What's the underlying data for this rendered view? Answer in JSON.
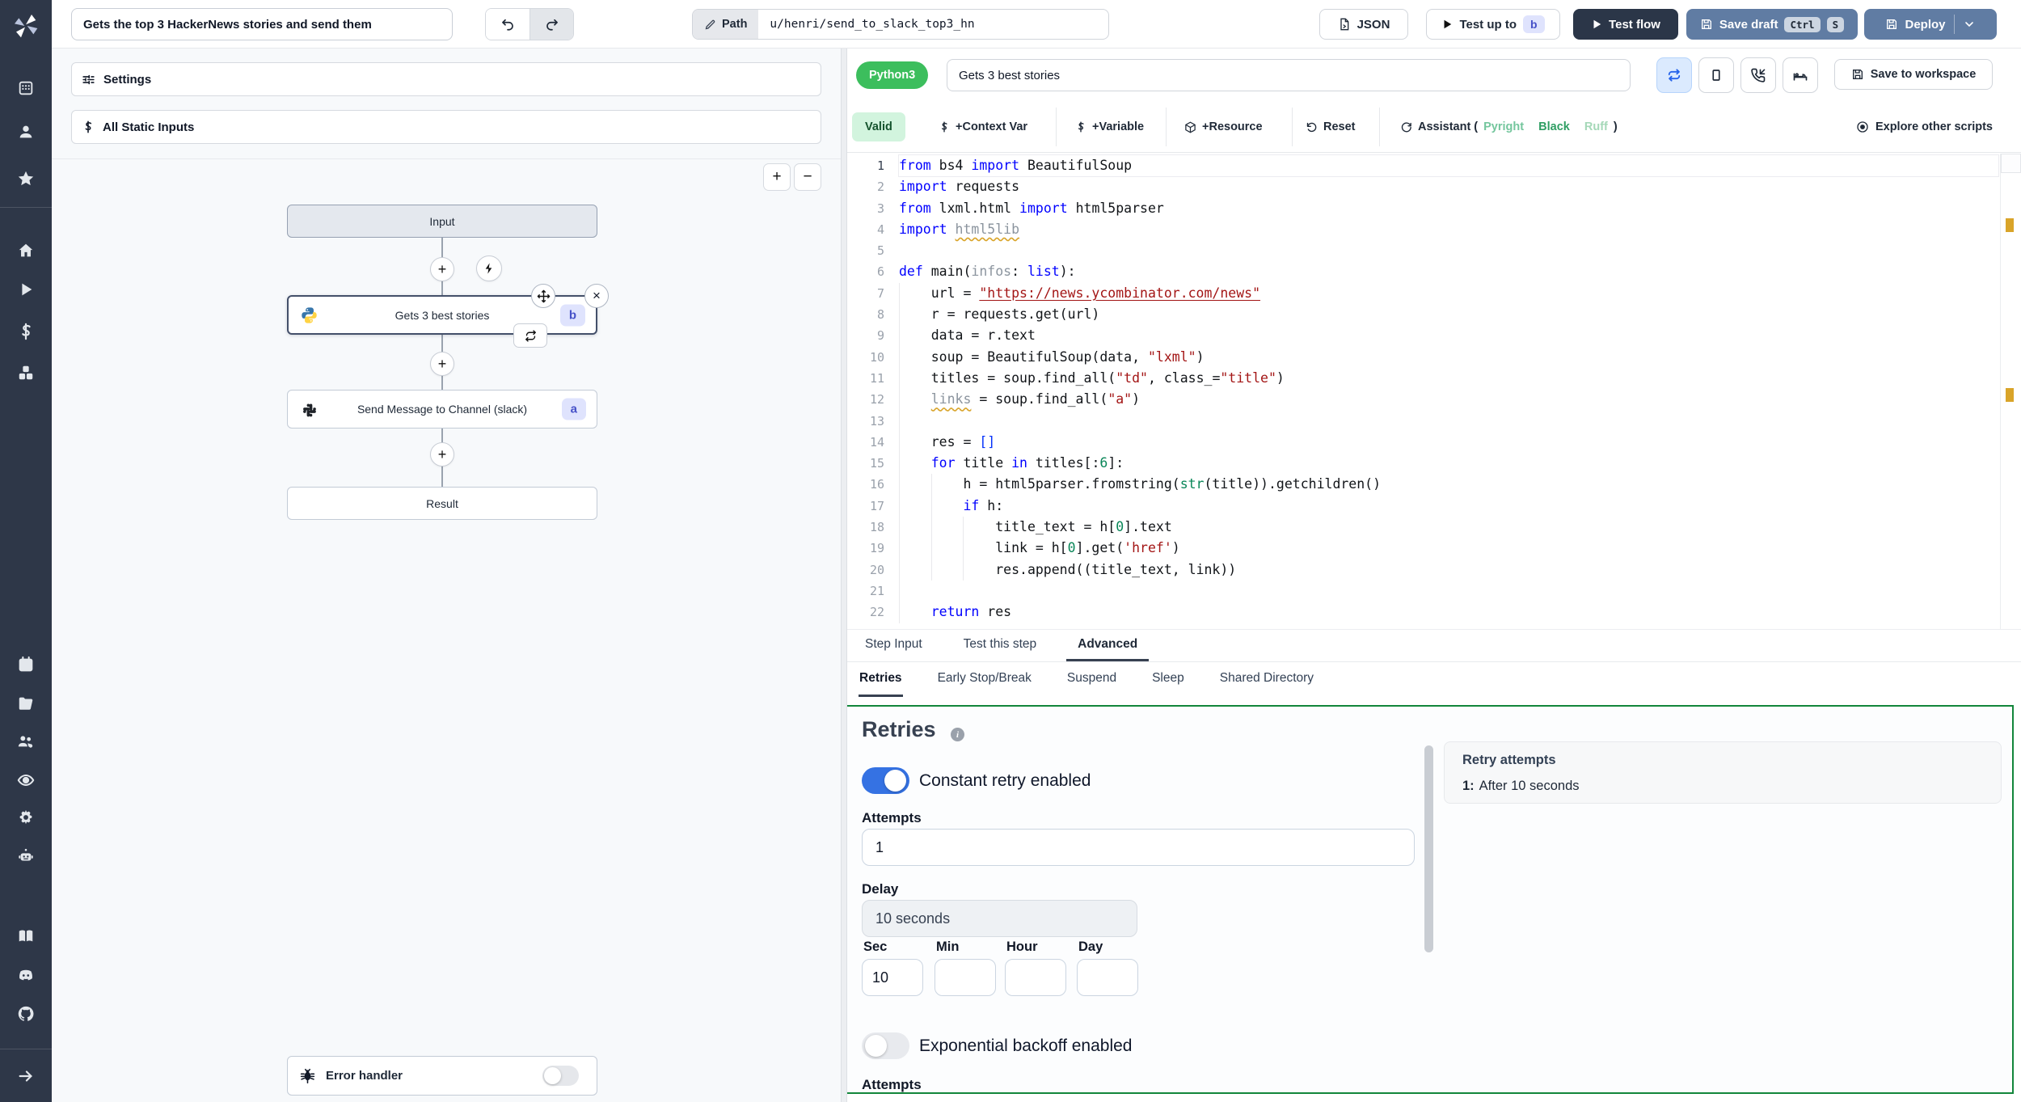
{
  "topbar": {
    "flow_title": "Gets the top 3 HackerNews stories and send them",
    "path_label": "Path",
    "path_value": "u/henri/send_to_slack_top3_hn",
    "json_label": "JSON",
    "test_up_to_label": "Test up to",
    "test_up_to_badge": "b",
    "test_flow_label": "Test flow",
    "save_draft_label": "Save draft",
    "save_draft_kbd": [
      "Ctrl",
      "S"
    ],
    "deploy_label": "Deploy"
  },
  "flow": {
    "settings_label": "Settings",
    "static_inputs_label": "All Static Inputs",
    "zoom_in": "+",
    "zoom_out": "−",
    "input_label": "Input",
    "step_b_label": "Gets 3 best stories",
    "step_b_badge": "b",
    "step_a_label": "Send Message to Channel (slack)",
    "step_a_badge": "a",
    "result_label": "Result",
    "error_handler_label": "Error handler"
  },
  "editor": {
    "language_badge": "Python3",
    "title_value": "Gets 3 best stories",
    "save_to_workspace_label": "Save to workspace",
    "valid_label": "Valid",
    "actions": [
      {
        "label": "+Context Var"
      },
      {
        "label": "+Variable"
      },
      {
        "label": "+Resource"
      },
      {
        "label": "Reset"
      }
    ],
    "assistant_prefix": "Assistant (",
    "assistant_linters": [
      {
        "name": "Pyright",
        "color": "#74c69d"
      },
      {
        "name": "Black",
        "color": "#2f9e63"
      },
      {
        "name": "Ruff",
        "color": "#a5d8b8"
      }
    ],
    "assistant_suffix": ")",
    "explore_label": "Explore other scripts",
    "accent_colors": {
      "valid_bg": "#d2f4de",
      "language_badge_bg": "#3cbe5d",
      "retry_border": "#12863b",
      "toggle_on": "#3572e3"
    },
    "code": {
      "lines": [
        [
          [
            "k",
            "from"
          ],
          [
            "p",
            " bs4 "
          ],
          [
            "k",
            "import"
          ],
          [
            "p",
            " BeautifulSoup"
          ]
        ],
        [
          [
            "k",
            "import"
          ],
          [
            "p",
            " requests"
          ]
        ],
        [
          [
            "k",
            "from"
          ],
          [
            "p",
            " lxml.html "
          ],
          [
            "k",
            "import"
          ],
          [
            "p",
            " html5parser"
          ]
        ],
        [
          [
            "k",
            "import"
          ],
          [
            "p",
            " "
          ],
          [
            "gw",
            "html5lib"
          ]
        ],
        [],
        [
          [
            "k",
            "def"
          ],
          [
            "p",
            " main("
          ],
          [
            "g",
            "infos"
          ],
          [
            "p",
            ": "
          ],
          [
            "k",
            "list"
          ],
          [
            "p",
            "):"
          ]
        ],
        [
          [
            "p",
            "    url = "
          ],
          [
            "su",
            "\"https://news.ycombinator.com/news\""
          ]
        ],
        [
          [
            "p",
            "    r = requests.get(url)"
          ]
        ],
        [
          [
            "p",
            "    data = r.text"
          ]
        ],
        [
          [
            "p",
            "    soup = BeautifulSoup(data, "
          ],
          [
            "s",
            "\"lxml\""
          ],
          [
            "p",
            ")"
          ]
        ],
        [
          [
            "p",
            "    titles = soup.find_all("
          ],
          [
            "s",
            "\"td\""
          ],
          [
            "p",
            ", class_="
          ],
          [
            "s",
            "\"title\""
          ],
          [
            "p",
            ")"
          ]
        ],
        [
          [
            "p",
            "    "
          ],
          [
            "gw",
            "links"
          ],
          [
            "p",
            " = soup.find_all("
          ],
          [
            "s",
            "\"a\""
          ],
          [
            "p",
            ")"
          ]
        ],
        [],
        [
          [
            "p",
            "    res = "
          ],
          [
            "b",
            "[]"
          ]
        ],
        [
          [
            "p",
            "    "
          ],
          [
            "k",
            "for"
          ],
          [
            "p",
            " title "
          ],
          [
            "k",
            "in"
          ],
          [
            "p",
            " titles[:"
          ],
          [
            "n",
            "6"
          ],
          [
            "p",
            "]:"
          ]
        ],
        [
          [
            "p",
            "        h = html5parser.fromstring("
          ],
          [
            "n",
            "str"
          ],
          [
            "p",
            "(title)).getchildren()"
          ]
        ],
        [
          [
            "p",
            "        "
          ],
          [
            "k",
            "if"
          ],
          [
            "p",
            " h:"
          ]
        ],
        [
          [
            "p",
            "            title_text = h["
          ],
          [
            "n",
            "0"
          ],
          [
            "p",
            "].text"
          ]
        ],
        [
          [
            "p",
            "            link = h["
          ],
          [
            "n",
            "0"
          ],
          [
            "p",
            "].get("
          ],
          [
            "s",
            "'href'"
          ],
          [
            "p",
            ")"
          ]
        ],
        [
          [
            "p",
            "            res.append((title_text, link))"
          ]
        ],
        [],
        [
          [
            "p",
            "    "
          ],
          [
            "k",
            "return"
          ],
          [
            "p",
            " res"
          ]
        ]
      ]
    }
  },
  "tabs": {
    "main": [
      {
        "label": "Step Input"
      },
      {
        "label": "Test this step"
      },
      {
        "label": "Advanced"
      }
    ],
    "sub": [
      {
        "label": "Retries"
      },
      {
        "label": "Early Stop/Break"
      },
      {
        "label": "Suspend"
      },
      {
        "label": "Sleep"
      },
      {
        "label": "Shared Directory"
      }
    ]
  },
  "retries": {
    "heading": "Retries",
    "constant_toggle_label": "Constant retry enabled",
    "attempts_label": "Attempts",
    "attempts_value": "1",
    "delay_label": "Delay",
    "delay_value": "10 seconds",
    "time_fields": [
      {
        "label": "Sec",
        "value": "10"
      },
      {
        "label": "Min",
        "value": ""
      },
      {
        "label": "Hour",
        "value": ""
      },
      {
        "label": "Day",
        "value": ""
      }
    ],
    "exponential_toggle_label": "Exponential backoff enabled",
    "clipped_label": "Attempts",
    "summary": {
      "title": "Retry attempts",
      "item_index": "1:",
      "item_text": "After 10 seconds"
    }
  }
}
